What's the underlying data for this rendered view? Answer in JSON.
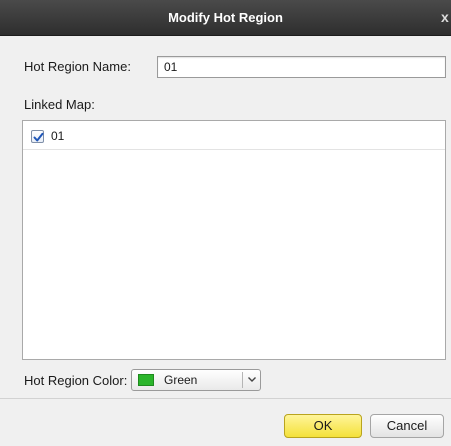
{
  "dialog": {
    "title": "Modify Hot Region",
    "close_glyph": "x"
  },
  "form": {
    "name_label": "Hot Region Name:",
    "name_value": "01",
    "linked_map_label": "Linked Map:",
    "linked_maps": [
      {
        "label": "01",
        "checked": true
      }
    ],
    "color_label": "Hot Region Color:",
    "color_value": "Green",
    "color_swatch": "#2bb52b"
  },
  "footer": {
    "ok_label": "OK",
    "cancel_label": "Cancel"
  },
  "icons": {
    "close": "close-icon",
    "check": "checkmark-icon",
    "dropdown": "chevron-down-icon"
  }
}
